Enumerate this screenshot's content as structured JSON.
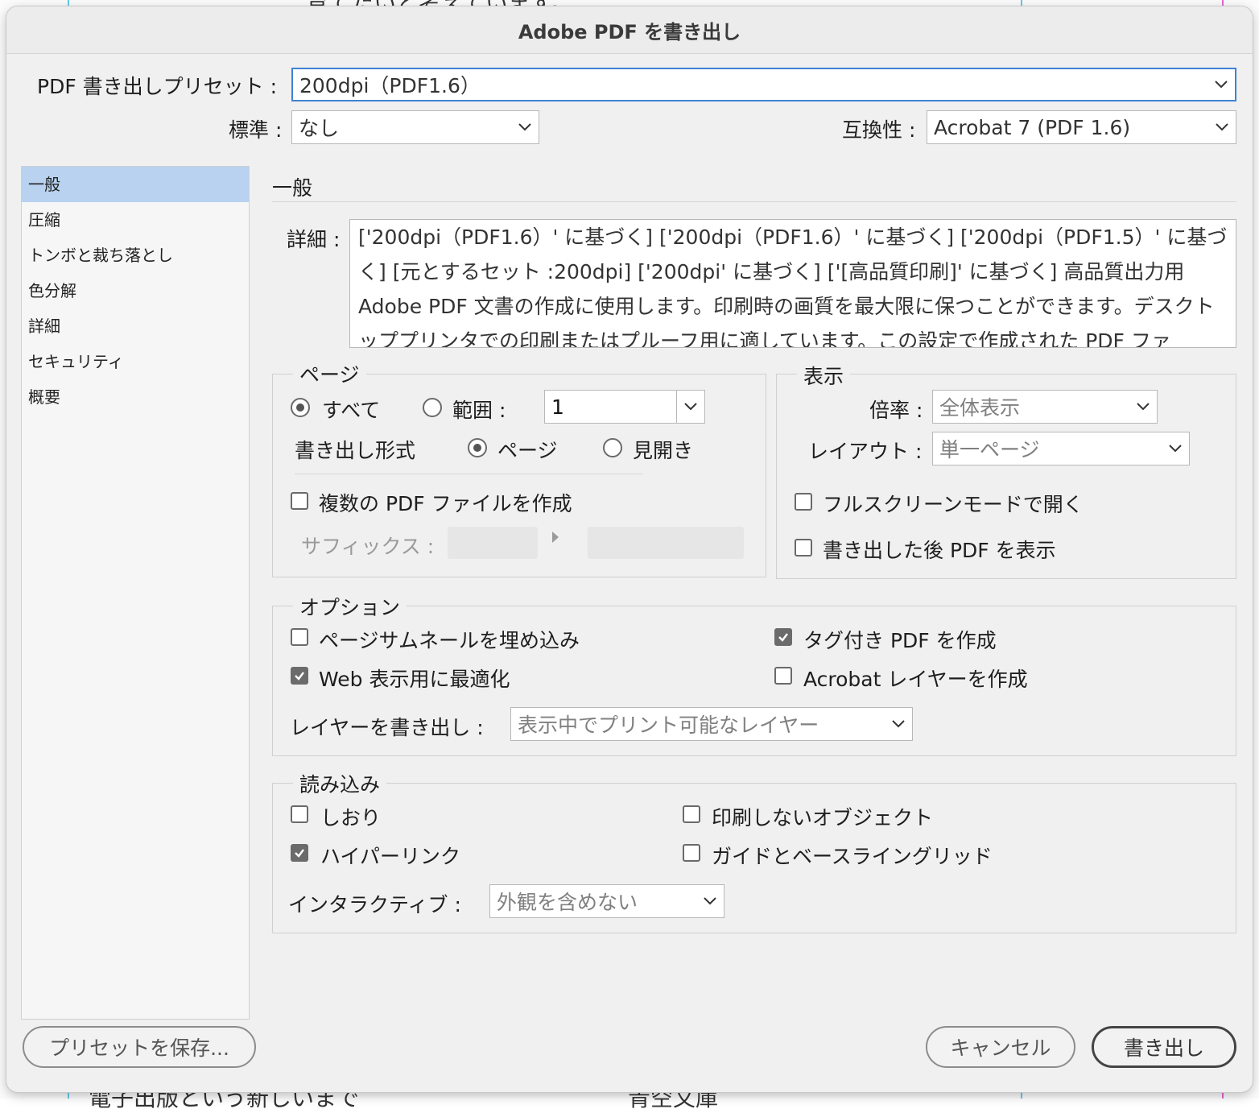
{
  "background": {
    "top_text": "育てたいと考えています。",
    "bottom_left_text": "電子出版という新しいまで",
    "bottom_right_text": "青空文庫"
  },
  "dialog": {
    "title": "Adobe PDF を書き出し",
    "preset": {
      "label": "PDF 書き出しプリセット :",
      "value": "200dpi（PDF1.6）"
    },
    "standard": {
      "label": "標準 :",
      "value": "なし"
    },
    "compat": {
      "label": "互換性 :",
      "value": "Acrobat 7 (PDF 1.6)"
    }
  },
  "sidebar": {
    "items": [
      {
        "label": "一般",
        "selected": true
      },
      {
        "label": "圧縮",
        "selected": false
      },
      {
        "label": "トンボと裁ち落とし",
        "selected": false
      },
      {
        "label": "色分解",
        "selected": false
      },
      {
        "label": "詳細",
        "selected": false
      },
      {
        "label": "セキュリティ",
        "selected": false
      },
      {
        "label": "概要",
        "selected": false
      }
    ]
  },
  "general": {
    "title": "一般",
    "detail_label": "詳細 :",
    "detail_text": "['200dpi（PDF1.6）' に基づく] ['200dpi（PDF1.6）' に基づく] ['200dpi（PDF1.5）' に基づく] [元とするセット :200dpi] ['200dpi' に基づく] ['[高品質印刷]' に基づく] 高品質出力用 Adobe PDF 文書の作成に使用します。印刷時の画質を最大限に保つことができます。デスクトッププリンタでの印刷またはプルーフ用に適しています。この設定で作成された PDF ファ"
  },
  "pages": {
    "legend": "ページ",
    "all_label": "すべて",
    "range_label": "範囲 :",
    "range_value": "1",
    "export_as_label": "書き出し形式",
    "page_label": "ページ",
    "spread_label": "見開き",
    "multi_pdf_label": "複数の PDF ファイルを作成",
    "suffix_label": "サフィックス :"
  },
  "view": {
    "legend": "表示",
    "zoom_label": "倍率 :",
    "zoom_value": "全体表示",
    "layout_label": "レイアウト :",
    "layout_value": "単一ページ",
    "fullscreen_label": "フルスクリーンモードで開く",
    "view_after_label": "書き出した後 PDF を表示"
  },
  "options": {
    "legend": "オプション",
    "thumbnails_label": "ページサムネールを埋め込み",
    "web_label": "Web 表示用に最適化",
    "tagged_label": "タグ付き PDF を作成",
    "acrobat_layers_label": "Acrobat レイヤーを作成",
    "export_layers_label": "レイヤーを書き出し :",
    "export_layers_value": "表示中でプリント可能なレイヤー"
  },
  "include": {
    "legend": "読み込み",
    "bookmarks_label": "しおり",
    "hyperlinks_label": "ハイパーリンク",
    "nonprint_label": "印刷しないオブジェクト",
    "guides_label": "ガイドとベースライングリッド",
    "interactive_label": "インタラクティブ :",
    "interactive_value": "外観を含めない"
  },
  "buttons": {
    "save_preset": "プリセットを保存...",
    "cancel": "キャンセル",
    "export": "書き出し"
  },
  "colors": {
    "accent": "#3f82d4",
    "selection": "#b8d2f0",
    "checked": "#6b6b6b"
  }
}
